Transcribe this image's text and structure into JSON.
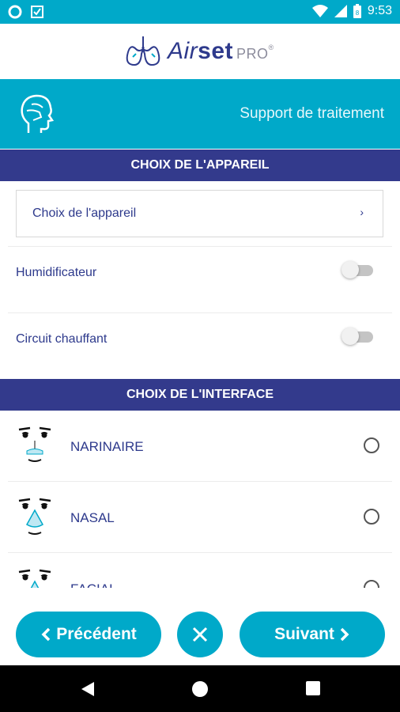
{
  "status_bar": {
    "time": "9:53",
    "icons": [
      "circle-notification-icon",
      "check-notification-icon",
      "wifi-icon",
      "cell-signal-icon",
      "battery-icon"
    ]
  },
  "logo": {
    "air": "Air",
    "set": "set",
    "pro": "PRO",
    "mark": "®"
  },
  "header": {
    "title": "Support de traitement",
    "icon": "head-profile-icon"
  },
  "device_section": {
    "title": "CHOIX DE L'APPAREIL",
    "select_label": "Choix de l'appareil",
    "chevron": "›"
  },
  "toggles": [
    {
      "label": "Humidificateur",
      "on": false
    },
    {
      "label": "Circuit chauffant",
      "on": false
    }
  ],
  "interface_section": {
    "title": "CHOIX DE L'INTERFACE",
    "items": [
      {
        "label": "NARINAIRE",
        "icon": "nasal-pillows-face-icon",
        "selected": false
      },
      {
        "label": "NASAL",
        "icon": "nasal-mask-face-icon",
        "selected": false
      },
      {
        "label": "FACIAL",
        "icon": "full-face-mask-icon",
        "selected": false
      }
    ]
  },
  "actions": {
    "prev_label": "Précédent",
    "next_label": "Suivant",
    "close_icon": "close-icon"
  },
  "colors": {
    "accent": "#00a9c9",
    "section_bar": "#333a8c",
    "text_primary": "#2e3a8c"
  }
}
